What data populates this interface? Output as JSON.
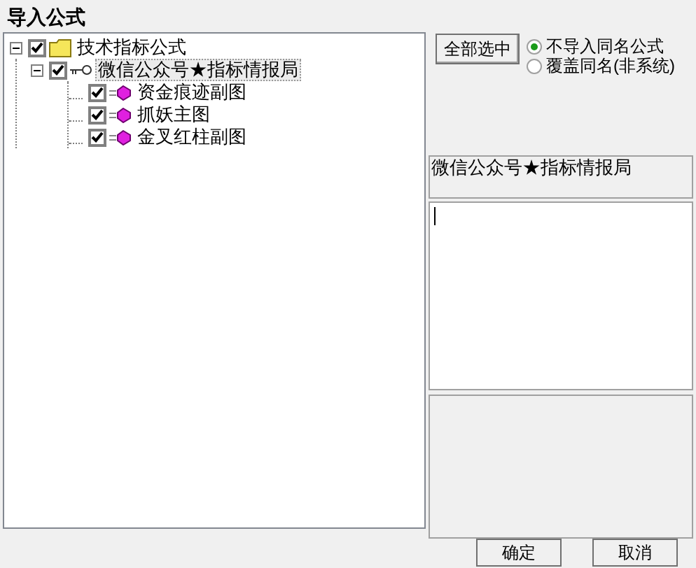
{
  "window": {
    "title": "导入公式"
  },
  "tree": [
    {
      "label": "技术指标公式",
      "kind": "folder",
      "checked": true,
      "expanded": true,
      "selected": false,
      "children": [
        {
          "label": "微信公众号★指标情报局",
          "kind": "group",
          "checked": true,
          "expanded": true,
          "selected": true,
          "children": [
            {
              "label": "资金痕迹副图",
              "kind": "formula",
              "checked": true,
              "selected": false
            },
            {
              "label": "抓妖主图",
              "kind": "formula",
              "checked": true,
              "selected": false
            },
            {
              "label": "金叉红柱副图",
              "kind": "formula",
              "checked": true,
              "selected": false
            }
          ]
        }
      ]
    }
  ],
  "select_all_button": "全部选中",
  "options": [
    {
      "label": "不导入同名公式",
      "selected": true
    },
    {
      "label": "覆盖同名(非系统)",
      "selected": false
    }
  ],
  "name_box": {
    "value": "微信公众号★指标情报局"
  },
  "buttons": [
    "确定",
    "取消"
  ]
}
